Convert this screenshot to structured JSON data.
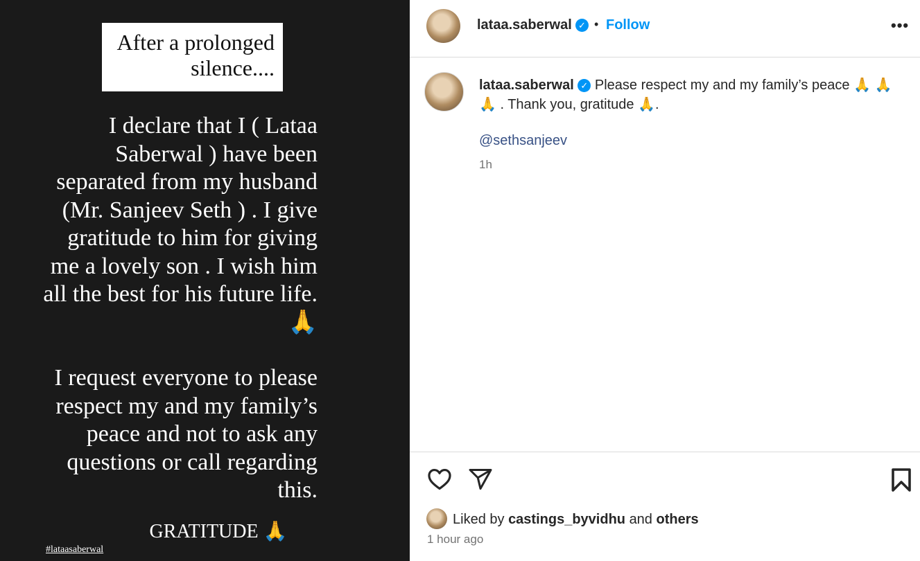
{
  "story": {
    "title": "After a prolonged silence....",
    "para1": "I declare that I ( Lataa Saberwal ) have been separated from my husband (Mr. Sanjeev Seth ) . I give gratitude to him for giving me a lovely son .  I wish him all the best for his future life. 🙏",
    "para2": "I request everyone to please  respect my and my family’s peace and not to ask any questions or call regarding this.",
    "gratitude": "GRATITUDE 🙏",
    "hashtag": "#lataasaberwal"
  },
  "post": {
    "username": "lataa.saberwal",
    "verified_icon": "verified-badge",
    "separator": "•",
    "follow_label": "Follow",
    "more_label": "•••",
    "caption_user": "lataa.saberwal",
    "caption_text": "Please respect my and my family’s peace 🙏 🙏 🙏 . Thank you, gratitude 🙏.",
    "mention": "@sethsanjeev",
    "caption_time": "1h",
    "liked_prefix": "Liked by",
    "liked_user": "castings_byvidhu",
    "liked_and": "and",
    "liked_others": "others",
    "post_time": "1 hour ago"
  },
  "colors": {
    "story_bg": "#1a1a1a",
    "link_blue": "#0095f6",
    "mention": "#385185",
    "muted": "#737373"
  }
}
